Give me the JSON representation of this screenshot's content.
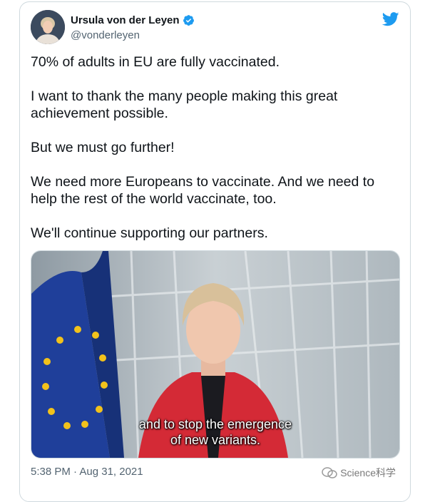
{
  "author": {
    "name": "Ursula von der Leyen",
    "handle": "@vonderleyen"
  },
  "tweet": {
    "paragraphs": [
      "70% of adults in EU are fully vaccinated.",
      "I want to thank the many people making this great achievement possible.",
      "But we must go further!",
      "We need more Europeans to vaccinate. And we need to help the rest of the world vaccinate, too.",
      "We'll continue supporting our partners."
    ]
  },
  "video": {
    "subtitle_line1": "and to stop the emergence",
    "subtitle_line2": "of new variants."
  },
  "timestamp": "5:38 PM · Aug 31, 2021",
  "watermark": {
    "text": "Science科学"
  },
  "colors": {
    "twitter_blue": "#1d9bf0",
    "text": "#0f1419",
    "secondary_text": "#536471",
    "border": "#cfd9de",
    "eu_flag_blue": "#1f3f9a",
    "eu_star_yellow": "#f2c21b",
    "jacket_red": "#d42a36"
  },
  "icons": [
    "verified-badge-icon",
    "twitter-bird-icon",
    "watermark-logo-icon"
  ]
}
